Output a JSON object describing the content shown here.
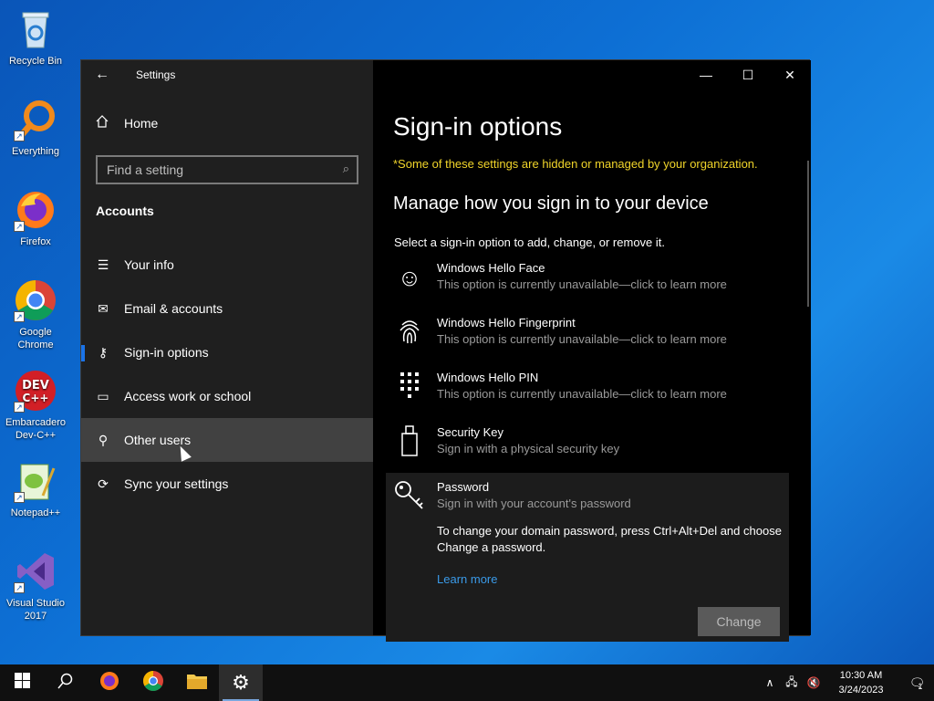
{
  "desktop": {
    "icons": [
      {
        "label": "Recycle Bin",
        "icon": "recycle-bin-icon"
      },
      {
        "label": "Everything",
        "icon": "everything-search-icon"
      },
      {
        "label": "Firefox",
        "icon": "firefox-icon"
      },
      {
        "label": "Google Chrome",
        "icon": "chrome-icon"
      },
      {
        "label": "Embarcadero Dev-C++",
        "icon": "devcpp-icon"
      },
      {
        "label": "Notepad++",
        "icon": "notepadpp-icon"
      },
      {
        "label": "Visual Studio 2017",
        "icon": "visual-studio-icon"
      }
    ]
  },
  "window": {
    "title": "Settings",
    "controls": {
      "minimize": "—",
      "maximize": "☐",
      "close": "✕"
    }
  },
  "sidebar": {
    "home": "Home",
    "search_placeholder": "Find a setting",
    "section": "Accounts",
    "items": [
      {
        "label": "Your info",
        "icon": "person-list-icon"
      },
      {
        "label": "Email & accounts",
        "icon": "mail-icon"
      },
      {
        "label": "Sign-in options",
        "icon": "key-icon"
      },
      {
        "label": "Access work or school",
        "icon": "briefcase-icon"
      },
      {
        "label": "Other users",
        "icon": "person-add-icon"
      },
      {
        "label": "Sync your settings",
        "icon": "sync-icon"
      }
    ]
  },
  "main": {
    "title": "Sign-in options",
    "org_note": "*Some of these settings are hidden or managed by your organization.",
    "subheading": "Manage how you sign in to your device",
    "instruction": "Select a sign-in option to add, change, or remove it.",
    "options": [
      {
        "title": "Windows Hello Face",
        "desc": "This option is currently unavailable—click to learn more",
        "icon": "face-icon"
      },
      {
        "title": "Windows Hello Fingerprint",
        "desc": "This option is currently unavailable—click to learn more",
        "icon": "fingerprint-icon"
      },
      {
        "title": "Windows Hello PIN",
        "desc": "This option is currently unavailable—click to learn more",
        "icon": "pin-keypad-icon"
      },
      {
        "title": "Security Key",
        "desc": "Sign in with a physical security key",
        "icon": "usb-key-icon"
      },
      {
        "title": "Password",
        "desc": "Sign in with your account's password",
        "icon": "password-key-icon"
      }
    ],
    "password_detail": "To change your domain password, press Ctrl+Alt+Del and choose Change a password.",
    "learn_more": "Learn more",
    "change_button": "Change"
  },
  "taskbar": {
    "time": "10:30 AM",
    "date": "3/24/2023",
    "notification_count": "1"
  },
  "colors": {
    "accent": "#1a73e8",
    "warning_text": "#f1d52a",
    "link": "#3a9ae8"
  }
}
